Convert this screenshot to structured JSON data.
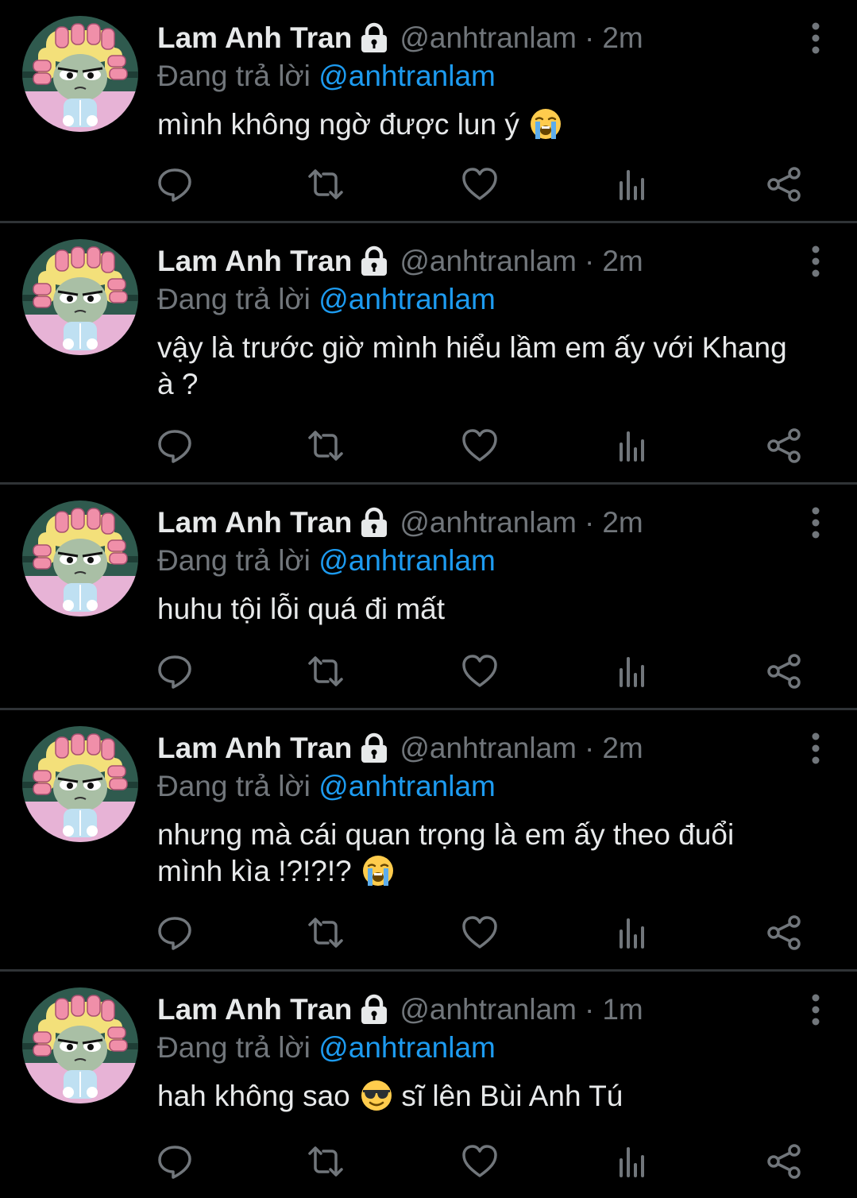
{
  "colors": {
    "background": "#000000",
    "divider": "#2f3336",
    "primary_text": "#e7e9ea",
    "secondary_text": "#71767b",
    "accent": "#1d9bf0"
  },
  "icons": {
    "lock": "lock-icon",
    "more": "more-vertical-icon",
    "reply": "reply-icon",
    "retweet": "retweet-icon",
    "like": "heart-icon",
    "views": "analytics-icon",
    "share": "share-icon"
  },
  "tweets": [
    {
      "name": "Lam Anh Tran",
      "handle": "@anhtranlam",
      "separator": "·",
      "time": "2m",
      "replying_prefix": "Đang trả lời ",
      "replying_to": "@anhtranlam",
      "text": "mình không ngờ được lun ý ",
      "emoji": "loudly-crying-face"
    },
    {
      "name": "Lam Anh Tran",
      "handle": "@anhtranlam",
      "separator": "·",
      "time": "2m",
      "replying_prefix": "Đang trả lời ",
      "replying_to": "@anhtranlam",
      "text": "vậy là trước giờ mình hiểu lầm em ấy với Khang\nà ?",
      "emoji": ""
    },
    {
      "name": "Lam Anh Tran",
      "handle": "@anhtranlam",
      "separator": "·",
      "time": "2m",
      "replying_prefix": "Đang trả lời ",
      "replying_to": "@anhtranlam",
      "text": "huhu tội lỗi quá đi mất",
      "emoji": ""
    },
    {
      "name": "Lam Anh Tran",
      "handle": "@anhtranlam",
      "separator": "·",
      "time": "2m",
      "replying_prefix": "Đang trả lời ",
      "replying_to": "@anhtranlam",
      "text": "nhưng mà cái quan trọng là em ấy theo đuổi\nmình kìa !?!?!? ",
      "emoji": "loudly-crying-face"
    },
    {
      "name": "Lam Anh Tran",
      "handle": "@anhtranlam",
      "separator": "·",
      "time": "1m",
      "replying_prefix": "Đang trả lời ",
      "replying_to": "@anhtranlam",
      "text_before": "hah không sao ",
      "emoji": "smiling-face-with-sunglasses",
      "text_after": " sĩ lên Bùi Anh Tú"
    }
  ]
}
